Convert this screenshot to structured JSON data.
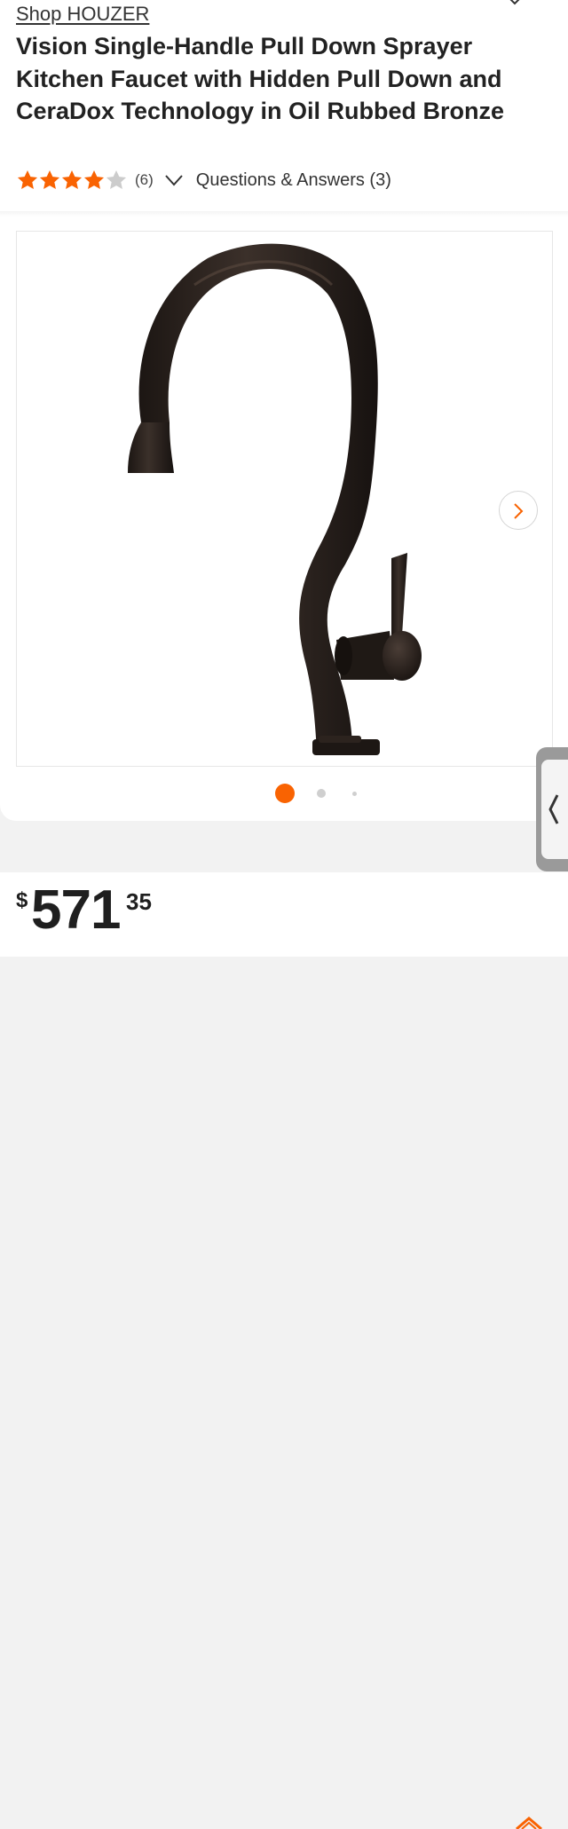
{
  "brand": {
    "shop_link": "Shop HOUZER"
  },
  "product": {
    "title": "Vision Single-Handle Pull Down Sprayer Kitchen Faucet with Hidden Pull Down and CeraDox Technology in Oil Rubbed Bronze"
  },
  "rating": {
    "stars": 4,
    "max_stars": 5,
    "review_count": "(6)",
    "qa_link": "Questions & Answers (3)"
  },
  "gallery": {
    "image_icon": "faucet-image",
    "next_icon": "chevron-right-icon",
    "image_count": 3,
    "current_index": 1
  },
  "price": {
    "currency": "$",
    "dollars": "571",
    "cents": "35"
  },
  "colors": {
    "accent": "#f96302",
    "star": "#f96302",
    "star_empty": "#cccccc",
    "bronze": "#2a221e"
  },
  "icons": {
    "collapse": "chevron-down-icon",
    "expand": "chevron-down-icon",
    "side_tab": "chevron-left-icon",
    "badge": "orange-badge-icon"
  }
}
